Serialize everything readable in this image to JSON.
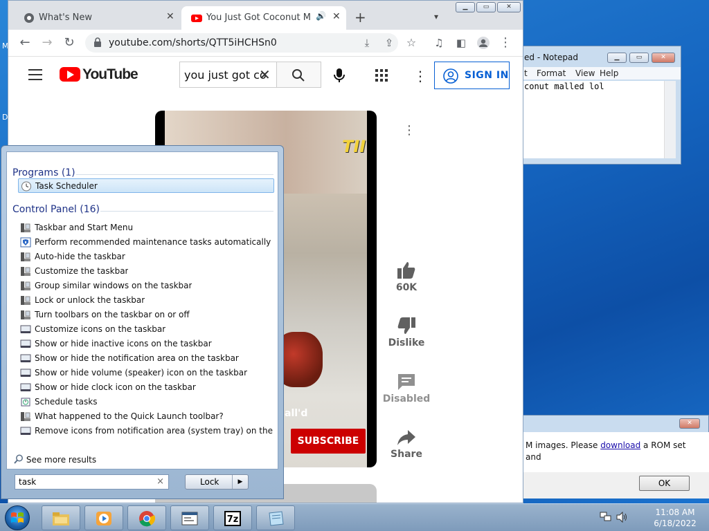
{
  "desktop": {
    "fragments": [
      "M",
      "D"
    ]
  },
  "notepad": {
    "title": "ed - Notepad",
    "menu": [
      "t",
      "Format",
      "View",
      "Help"
    ],
    "content": "conut malled lol"
  },
  "dialog": {
    "msg_before": "M images. Please ",
    "msg_link": "download",
    "msg_after": " a ROM set and",
    "ok_label": "OK"
  },
  "chrome": {
    "tabs": [
      {
        "label": "What's New",
        "active": false
      },
      {
        "label": "You Just Got Coconut Mall'd",
        "active": true
      }
    ],
    "url": "youtube.com/shorts/QTT5iHCHSn0"
  },
  "youtube": {
    "logo_text": "YouTube",
    "search_value": "you just got co",
    "signin_label": "SIGN IN",
    "video_overlay_text": "all'd",
    "subscribe_label": "SUBSCRIBE",
    "sign_text": "TII",
    "actions": {
      "likes": "60K",
      "dislike": "Dislike",
      "comments": "Disabled",
      "share": "Share"
    },
    "brand_color": "#ff0000"
  },
  "startmenu": {
    "programs_header": "Programs (1)",
    "programs": [
      {
        "label": "Task Scheduler",
        "icon": "clock-icon",
        "selected": true
      }
    ],
    "control_panel_header": "Control Panel (16)",
    "control_panel": [
      {
        "label": "Taskbar and Start Menu",
        "icon": "taskbar-icon"
      },
      {
        "label": "Perform recommended maintenance tasks automatically",
        "icon": "action-center-icon"
      },
      {
        "label": "Auto-hide the taskbar",
        "icon": "taskbar-icon"
      },
      {
        "label": "Customize the taskbar",
        "icon": "taskbar-icon"
      },
      {
        "label": "Group similar windows on the taskbar",
        "icon": "taskbar-icon"
      },
      {
        "label": "Lock or unlock the taskbar",
        "icon": "taskbar-icon"
      },
      {
        "label": "Turn toolbars on the taskbar on or off",
        "icon": "taskbar-icon"
      },
      {
        "label": "Customize icons on the taskbar",
        "icon": "notification-icon"
      },
      {
        "label": "Show or hide inactive icons on the taskbar",
        "icon": "notification-icon"
      },
      {
        "label": "Show or hide the notification area on the taskbar",
        "icon": "notification-icon"
      },
      {
        "label": "Show or hide volume (speaker) icon on the taskbar",
        "icon": "notification-icon"
      },
      {
        "label": "Show or hide clock icon on the taskbar",
        "icon": "notification-icon"
      },
      {
        "label": "Schedule tasks",
        "icon": "admin-tools-icon"
      },
      {
        "label": "What happened to the Quick Launch toolbar?",
        "icon": "taskbar-icon"
      },
      {
        "label": "Remove icons from notification area (system tray) on the deskt...",
        "icon": "notification-icon"
      }
    ],
    "see_more": "See more results",
    "search_value": "task",
    "lock_label": "Lock"
  },
  "taskbar": {
    "apps": [
      "explorer",
      "media-player",
      "chrome",
      "mame",
      "7zip",
      "notepad"
    ],
    "time": "11:08 AM",
    "date": "6/18/2022"
  }
}
